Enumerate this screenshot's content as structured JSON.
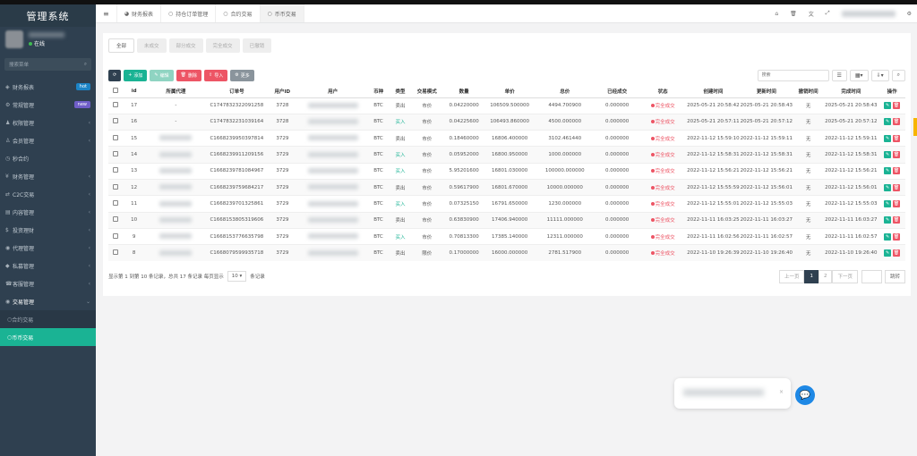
{
  "app": {
    "title": "管理系统",
    "user_status": "在线",
    "search_placeholder": "搜索菜单"
  },
  "menu": [
    {
      "label": "财务报表",
      "icon": "chart-icon",
      "badge": "hot",
      "badge_type": "hot"
    },
    {
      "label": "常规管理",
      "icon": "gear-icon",
      "badge": "new",
      "badge_type": "new"
    },
    {
      "label": "权限管理",
      "icon": "users-icon",
      "arrow": "‹"
    },
    {
      "label": "会员管理",
      "icon": "user-icon",
      "arrow": "‹"
    },
    {
      "label": "秒合约",
      "icon": "clock-icon",
      "arrow": ""
    },
    {
      "label": "财务管理",
      "icon": "money-icon",
      "arrow": "‹"
    },
    {
      "label": "C2C交易",
      "icon": "exchange-icon",
      "arrow": "‹"
    },
    {
      "label": "内容管理",
      "icon": "file-icon",
      "arrow": "‹"
    },
    {
      "label": "投资理财",
      "icon": "invest-icon",
      "arrow": "‹"
    },
    {
      "label": "代理管理",
      "icon": "agent-icon",
      "arrow": "‹"
    },
    {
      "label": "私募管理",
      "icon": "diamond-icon",
      "arrow": "‹"
    },
    {
      "label": "客服管理",
      "icon": "headset-icon",
      "arrow": "‹"
    },
    {
      "label": "交易管理",
      "icon": "eye-icon",
      "arrow": "⌄",
      "open": true
    }
  ],
  "submenu": [
    {
      "label": "合约交易",
      "active": false
    },
    {
      "label": "币币交易",
      "active": true
    }
  ],
  "nav_tabs": [
    {
      "label": "财务报表",
      "icon": "dashboard-icon"
    },
    {
      "label": "持仓订单管理",
      "icon": "circle-icon"
    },
    {
      "label": "合约交易",
      "icon": "circle-icon"
    },
    {
      "label": "币币交易",
      "icon": "circle-icon",
      "active": true
    }
  ],
  "filter_tabs": [
    "全部",
    "未成交",
    "部分成交",
    "完全成交",
    "已撤销"
  ],
  "toolbar": {
    "add": "添加",
    "edit": "编辑",
    "delete": "删除",
    "import": "导入",
    "more": "更多",
    "search_placeholder": "搜索"
  },
  "columns": [
    "id",
    "所属代理",
    "订单号",
    "用户ID",
    "用户",
    "币种",
    "类型",
    "交易模式",
    "数量",
    "单价",
    "总价",
    "已经成交",
    "状态",
    "创建时间",
    "更新时间",
    "撤销时间",
    "完成时间",
    "操作"
  ],
  "rows": [
    {
      "id": "17",
      "agent": "-",
      "order": "C1747832322091258",
      "uid": "3728",
      "coin": "BTC",
      "type": "卖出",
      "type_cls": "sell",
      "mode": "市价",
      "qty": "0.04220000",
      "price": "106509.500000",
      "total": "4494.700900",
      "filled": "0.000000",
      "status": "完全成交",
      "created": "2025-05-21 20:58:42",
      "updated": "2025-05-21 20:58:43",
      "cancel": "无",
      "done": "2025-05-21 20:58:43"
    },
    {
      "id": "16",
      "agent": "-",
      "order": "C1747832231039164",
      "uid": "3728",
      "coin": "BTC",
      "type": "买入",
      "type_cls": "buy",
      "mode": "市价",
      "qty": "0.04225600",
      "price": "106493.860000",
      "total": "4500.000000",
      "filled": "0.000000",
      "status": "完全成交",
      "created": "2025-05-21 20:57:11",
      "updated": "2025-05-21 20:57:12",
      "cancel": "无",
      "done": "2025-05-21 20:57:12"
    },
    {
      "id": "15",
      "agent": "",
      "order": "C1668239950397814",
      "uid": "3729",
      "coin": "BTC",
      "type": "卖出",
      "type_cls": "sell",
      "mode": "市价",
      "qty": "0.18460000",
      "price": "16806.400000",
      "total": "3102.461440",
      "filled": "0.000000",
      "status": "完全成交",
      "created": "2022-11-12 15:59:10",
      "updated": "2022-11-12 15:59:11",
      "cancel": "无",
      "done": "2022-11-12 15:59:11"
    },
    {
      "id": "14",
      "agent": "",
      "order": "C1668239911209156",
      "uid": "3729",
      "coin": "BTC",
      "type": "买入",
      "type_cls": "buy",
      "mode": "市价",
      "qty": "0.05952000",
      "price": "16800.950000",
      "total": "1000.000000",
      "filled": "0.000000",
      "status": "完全成交",
      "created": "2022-11-12 15:58:31",
      "updated": "2022-11-12 15:58:31",
      "cancel": "无",
      "done": "2022-11-12 15:58:31"
    },
    {
      "id": "13",
      "agent": "",
      "order": "C1668239781084967",
      "uid": "3729",
      "coin": "BTC",
      "type": "买入",
      "type_cls": "buy",
      "mode": "市价",
      "qty": "5.95201600",
      "price": "16801.030000",
      "total": "100000.000000",
      "filled": "0.000000",
      "status": "完全成交",
      "created": "2022-11-12 15:56:21",
      "updated": "2022-11-12 15:56:21",
      "cancel": "无",
      "done": "2022-11-12 15:56:21"
    },
    {
      "id": "12",
      "agent": "",
      "order": "C1668239759684217",
      "uid": "3729",
      "coin": "BTC",
      "type": "卖出",
      "type_cls": "sell",
      "mode": "市价",
      "qty": "0.59617900",
      "price": "16801.670000",
      "total": "10000.000000",
      "filled": "0.000000",
      "status": "完全成交",
      "created": "2022-11-12 15:55:59",
      "updated": "2022-11-12 15:56:01",
      "cancel": "无",
      "done": "2022-11-12 15:56:01"
    },
    {
      "id": "11",
      "agent": "",
      "order": "C1668239701325861",
      "uid": "3729",
      "coin": "BTC",
      "type": "买入",
      "type_cls": "buy",
      "mode": "市价",
      "qty": "0.07325150",
      "price": "16791.650000",
      "total": "1230.000000",
      "filled": "0.000000",
      "status": "完全成交",
      "created": "2022-11-12 15:55:01",
      "updated": "2022-11-12 15:55:03",
      "cancel": "无",
      "done": "2022-11-12 15:55:03"
    },
    {
      "id": "10",
      "agent": "",
      "order": "C1668153805319606",
      "uid": "3729",
      "coin": "BTC",
      "type": "卖出",
      "type_cls": "sell",
      "mode": "市价",
      "qty": "0.63830900",
      "price": "17406.940000",
      "total": "11111.000000",
      "filled": "0.000000",
      "status": "完全成交",
      "created": "2022-11-11 16:03:25",
      "updated": "2022-11-11 16:03:27",
      "cancel": "无",
      "done": "2022-11-11 16:03:27"
    },
    {
      "id": "9",
      "agent": "",
      "order": "C1668153776635798",
      "uid": "3729",
      "coin": "BTC",
      "type": "买入",
      "type_cls": "buy",
      "mode": "市价",
      "qty": "0.70813300",
      "price": "17385.140000",
      "total": "12311.000000",
      "filled": "0.000000",
      "status": "完全成交",
      "created": "2022-11-11 16:02:56",
      "updated": "2022-11-11 16:02:57",
      "cancel": "无",
      "done": "2022-11-11 16:02:57"
    },
    {
      "id": "8",
      "agent": "",
      "order": "C1668079599935718",
      "uid": "3729",
      "coin": "BTC",
      "type": "卖出",
      "type_cls": "sell",
      "mode": "限价",
      "qty": "0.17000000",
      "price": "16000.000000",
      "total": "2781.517900",
      "filled": "0.000000",
      "status": "完全成交",
      "created": "2022-11-10 19:26:39",
      "updated": "2022-11-10 19:26:40",
      "cancel": "无",
      "done": "2022-11-10 19:26:40"
    }
  ],
  "footer": {
    "info": "显示第 1 到第 10 条记录，总共 17 条记录 每页显示",
    "page_size": "10",
    "per_page_suffix": "条记录"
  },
  "pager": {
    "prev": "上一页",
    "pages": [
      "1",
      "2"
    ],
    "current": "1",
    "next": "下一页",
    "go": "跳转"
  },
  "colors": {
    "sidebar": "#2f4050",
    "accent": "#1ab394",
    "danger": "#ed5565",
    "chat": "#1e88e5"
  }
}
